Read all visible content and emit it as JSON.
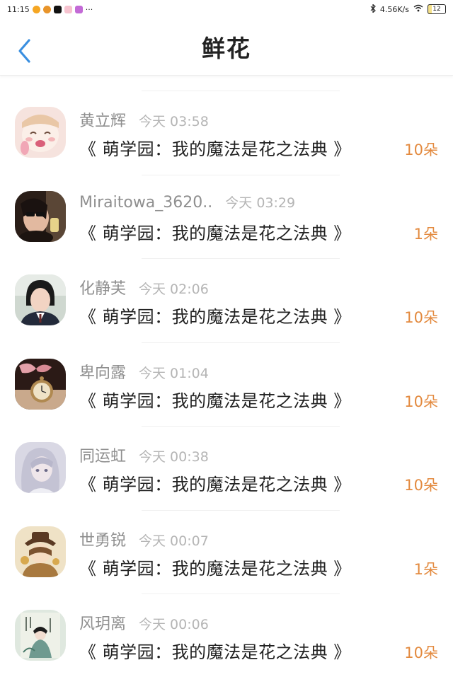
{
  "status_bar": {
    "time": "11:15",
    "more": "···",
    "network_speed": "4.56K/s",
    "battery": "12"
  },
  "header": {
    "title": "鲜花"
  },
  "gifts": [
    {
      "username": "黄立辉",
      "time": "今天 03:58",
      "book": "《 萌学园：我的魔法是花之法典 》",
      "amount": "10朵"
    },
    {
      "username": "Miraitowa_3620..",
      "time": "今天 03:29",
      "book": "《 萌学园：我的魔法是花之法典 》",
      "amount": "1朵"
    },
    {
      "username": "化静芙",
      "time": "今天 02:06",
      "book": "《 萌学园：我的魔法是花之法典 》",
      "amount": "10朵"
    },
    {
      "username": "卑向露",
      "time": "今天 01:04",
      "book": "《 萌学园：我的魔法是花之法典 》",
      "amount": "10朵"
    },
    {
      "username": "同运虹",
      "time": "今天 00:38",
      "book": "《 萌学园：我的魔法是花之法典 》",
      "amount": "10朵"
    },
    {
      "username": "世勇锐",
      "time": "今天 00:07",
      "book": "《 萌学园：我的魔法是花之法典 》",
      "amount": "1朵"
    },
    {
      "username": "风玥离",
      "time": "今天 00:06",
      "book": "《 萌学园：我的魔法是花之法典 》",
      "amount": "10朵"
    }
  ],
  "colors": {
    "accent_back": "#3a8fe0",
    "amount": "#e38a3f"
  }
}
